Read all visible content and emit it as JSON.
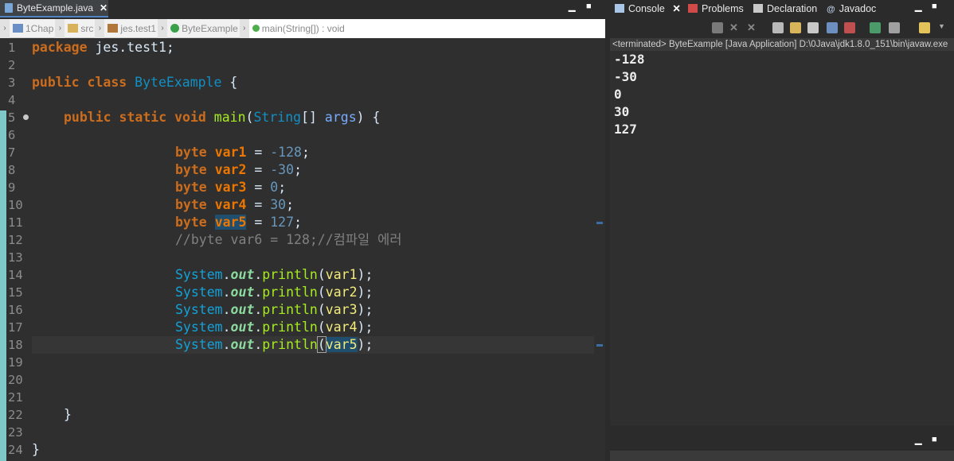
{
  "editor": {
    "tab": {
      "title": "ByteExample.java"
    },
    "breadcrumb": [
      "1Chap",
      "src",
      "jes.test1",
      "ByteExample",
      "main(String[]) : void"
    ],
    "line_numbers": [
      "1",
      "2",
      "3",
      "4",
      "5",
      "6",
      "7",
      "8",
      "9",
      "10",
      "11",
      "12",
      "13",
      "14",
      "15",
      "16",
      "17",
      "18",
      "19",
      "20",
      "21",
      "22",
      "23",
      "24"
    ],
    "code": {
      "l1_kw": "package",
      "l1_rest": " jes.test1;",
      "l3_kw1": "public",
      "l3_kw2": "class",
      "l3_name": "ByteExample",
      "l3_rest": " {",
      "l5_kw1": "public",
      "l5_kw2": "static",
      "l5_kw3": "void",
      "l5_fn": "main",
      "l5_p1": "(",
      "l5_cls": "String",
      "l5_p2": "[] ",
      "l5_arg": "args",
      "l5_p3": ") {",
      "decls": [
        {
          "type": "byte",
          "name": "var1",
          "op": " = ",
          "val": "-128",
          "end": ";"
        },
        {
          "type": "byte",
          "name": "var2",
          "op": " = ",
          "val": "-30",
          "end": ";"
        },
        {
          "type": "byte",
          "name": "var3",
          "op": " = ",
          "val": "0",
          "end": ";"
        },
        {
          "type": "byte",
          "name": "var4",
          "op": " = ",
          "val": "30",
          "end": ";"
        },
        {
          "type": "byte",
          "name": "var5",
          "op": " = ",
          "val": "127",
          "end": ";"
        }
      ],
      "comment": "//byte var6 = 128;//컴파일 에러",
      "prints": [
        {
          "sys": "System",
          "dot1": ".",
          "out": "out",
          "dot2": ".",
          "fn": "println",
          "open": "(",
          "arg": "var1",
          "close": ");"
        },
        {
          "sys": "System",
          "dot1": ".",
          "out": "out",
          "dot2": ".",
          "fn": "println",
          "open": "(",
          "arg": "var2",
          "close": ");"
        },
        {
          "sys": "System",
          "dot1": ".",
          "out": "out",
          "dot2": ".",
          "fn": "println",
          "open": "(",
          "arg": "var3",
          "close": ");"
        },
        {
          "sys": "System",
          "dot1": ".",
          "out": "out",
          "dot2": ".",
          "fn": "println",
          "open": "(",
          "arg": "var4",
          "close": ");"
        },
        {
          "sys": "System",
          "dot1": ".",
          "out": "out",
          "dot2": ".",
          "fn": "println",
          "open": "(",
          "arg": "var5",
          "close": ");"
        }
      ],
      "close_method": "}",
      "close_class": "}"
    }
  },
  "console_view": {
    "tabs": [
      "Console",
      "Problems",
      "Declaration",
      "Javadoc"
    ],
    "status": "<terminated> ByteExample [Java Application] D:\\0Java\\jdk1.8.0_151\\bin\\javaw.exe",
    "output": [
      "-128",
      "-30",
      "0",
      "30",
      "127"
    ]
  },
  "window_controls": {
    "minimize": "▁",
    "maximize": "■"
  },
  "colors": {
    "accent": "#4f84c5",
    "keyword": "#cc6c1d",
    "class": "#1290c3",
    "method": "#a7ec21",
    "variable": "#f3ec79",
    "number": "#6897bb"
  }
}
